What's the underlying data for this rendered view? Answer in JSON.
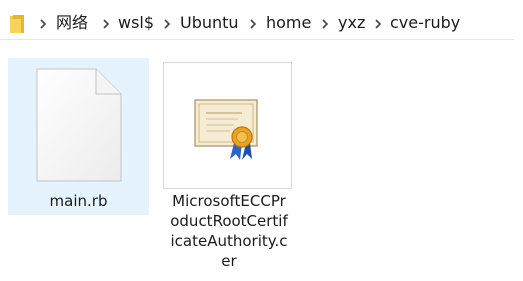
{
  "breadcrumb": {
    "items": [
      "网络",
      "wsl$",
      "Ubuntu",
      "home",
      "yxz",
      "cve-ruby"
    ]
  },
  "files": [
    {
      "name": "main.rb",
      "icon": "blank-file-icon",
      "selected": true
    },
    {
      "name": "MicrosoftECCProductRootCertificateAuthority.cer",
      "name_lines": [
        "MicrosoftECCPr",
        "oductRootCertif",
        "icateAuthority.c",
        "er"
      ],
      "icon": "certificate-icon",
      "selected": false
    }
  ],
  "colors": {
    "selection": "#e5f3ff",
    "folder": "#f5c842",
    "ribbon": "#2f63c9",
    "seal": "#e8a321"
  }
}
